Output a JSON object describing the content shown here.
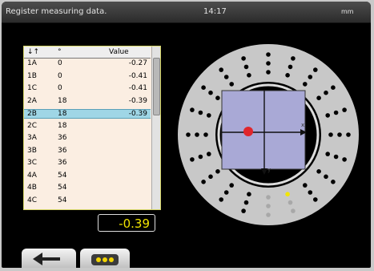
{
  "header": {
    "title": "Register measuring data.",
    "time": "14:17",
    "unit": "mm"
  },
  "table": {
    "columns": [
      "↓↑",
      "°",
      "Value"
    ],
    "rows": [
      {
        "id": "1A",
        "angle": "0",
        "value": "-0.27"
      },
      {
        "id": "1B",
        "angle": "0",
        "value": "-0.41"
      },
      {
        "id": "1C",
        "angle": "0",
        "value": "-0.41"
      },
      {
        "id": "2A",
        "angle": "18",
        "value": "-0.39"
      },
      {
        "id": "2B",
        "angle": "18",
        "value": "-0.39",
        "selected": true
      },
      {
        "id": "2C",
        "angle": "18",
        "value": ""
      },
      {
        "id": "3A",
        "angle": "36",
        "value": ""
      },
      {
        "id": "3B",
        "angle": "36",
        "value": ""
      },
      {
        "id": "3C",
        "angle": "36",
        "value": ""
      },
      {
        "id": "4A",
        "angle": "54",
        "value": ""
      },
      {
        "id": "4B",
        "angle": "54",
        "value": ""
      },
      {
        "id": "4C",
        "angle": "54",
        "value": ""
      }
    ]
  },
  "current_value": "-0.39",
  "buttons": {
    "back_icon": "arrow-left-icon",
    "menu_icon": "more-dots-icon"
  },
  "diagram": {
    "axis_labels": {
      "x": "x",
      "y": "y"
    },
    "colors": {
      "ring": "#c6c6c6",
      "target": "#a8a8d4",
      "point": "#e0262c",
      "active_hole": "#f2e600",
      "hole": "#000000",
      "inactive_hole": "#a8a8a8"
    }
  }
}
